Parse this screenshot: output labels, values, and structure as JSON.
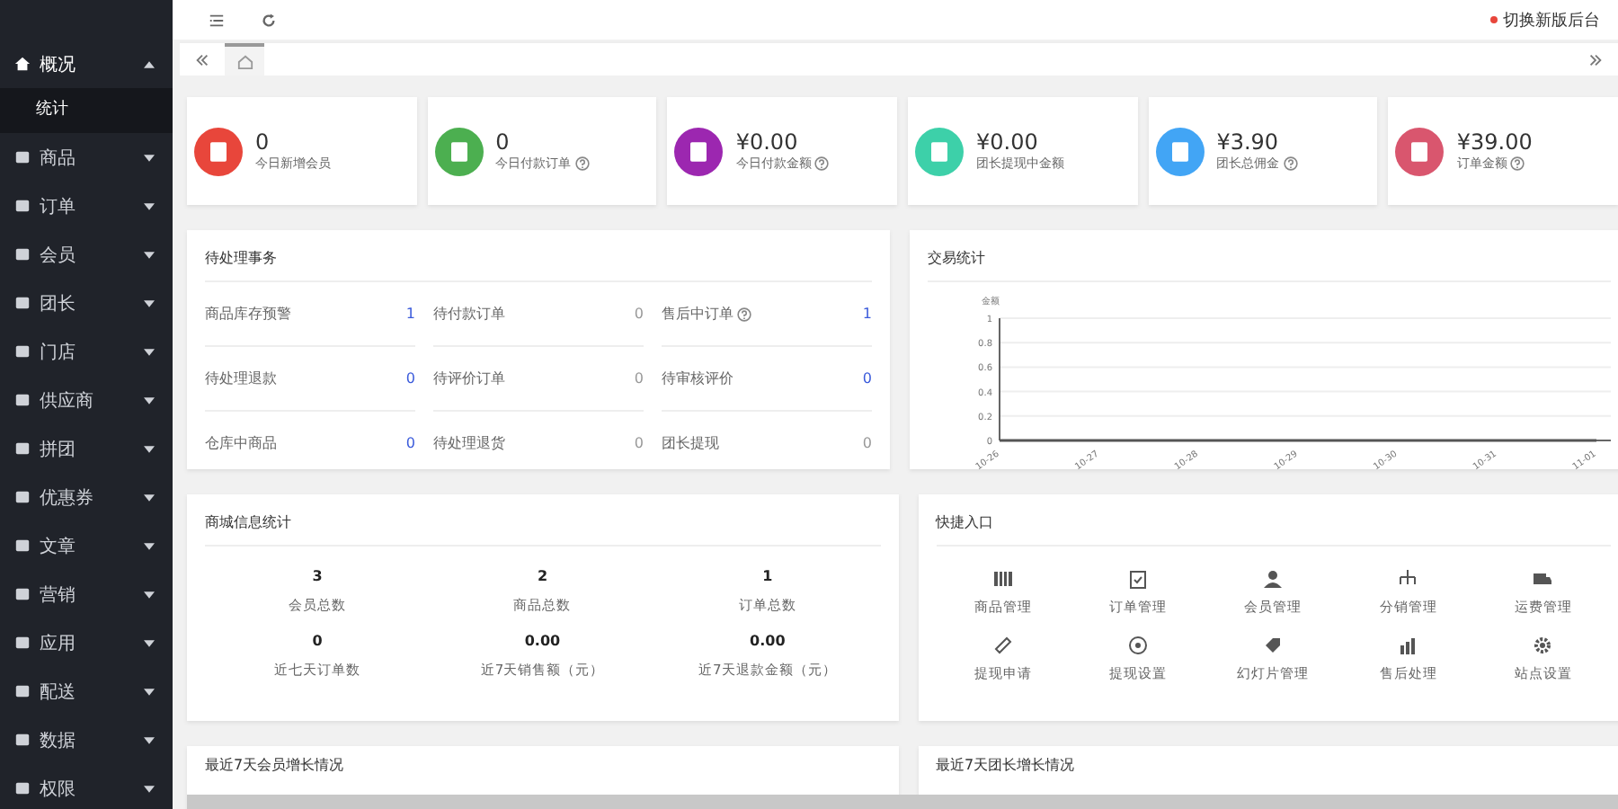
{
  "topbar": {
    "switch_link": "切换新版后台"
  },
  "sidebar": {
    "items": [
      {
        "label": "概况",
        "expanded": true,
        "children": [
          {
            "label": "统计",
            "selected": true
          }
        ]
      },
      {
        "label": "商品",
        "expanded": false
      },
      {
        "label": "订单",
        "expanded": false
      },
      {
        "label": "会员",
        "expanded": false
      },
      {
        "label": "团长",
        "expanded": false
      },
      {
        "label": "门店",
        "expanded": false
      },
      {
        "label": "供应商",
        "expanded": false
      },
      {
        "label": "拼团",
        "expanded": false
      },
      {
        "label": "优惠券",
        "expanded": false
      },
      {
        "label": "文章",
        "expanded": false
      },
      {
        "label": "营销",
        "expanded": false
      },
      {
        "label": "应用",
        "expanded": false
      },
      {
        "label": "配送",
        "expanded": false
      },
      {
        "label": "数据",
        "expanded": false
      },
      {
        "label": "权限",
        "expanded": false
      }
    ]
  },
  "stat_cards": [
    {
      "value": "0",
      "label": "今日新增会员",
      "help": false,
      "color": "#e8463b"
    },
    {
      "value": "0",
      "label": "今日付款订单",
      "help": true,
      "color": "#4caf50"
    },
    {
      "value": "¥0.00",
      "label": "今日付款金额",
      "help": true,
      "color": "#9c27b0"
    },
    {
      "value": "¥0.00",
      "label": "团长提现中金额",
      "help": false,
      "color": "#3dd0a9"
    },
    {
      "value": "¥3.90",
      "label": "团长总佣金",
      "help": true,
      "color": "#42a5f5"
    },
    {
      "value": "¥39.00",
      "label": "订单金额",
      "help": true,
      "color": "#d9566e"
    }
  ],
  "todo": {
    "title": "待处理事务",
    "items": [
      {
        "label": "商品库存预警",
        "help": false,
        "value": "1",
        "highlight": true
      },
      {
        "label": "待付款订单",
        "help": false,
        "value": "0",
        "highlight": false
      },
      {
        "label": "售后中订单",
        "help": true,
        "value": "1",
        "highlight": true
      },
      {
        "label": "待处理退款",
        "help": false,
        "value": "0",
        "highlight": true
      },
      {
        "label": "待评价订单",
        "help": false,
        "value": "0",
        "highlight": false
      },
      {
        "label": "待审核评价",
        "help": false,
        "value": "0",
        "highlight": true
      },
      {
        "label": "仓库中商品",
        "help": false,
        "value": "0",
        "highlight": true
      },
      {
        "label": "待处理退货",
        "help": false,
        "value": "0",
        "highlight": false
      },
      {
        "label": "团长提现",
        "help": false,
        "value": "0",
        "highlight": false
      }
    ]
  },
  "trade": {
    "title": "交易统计",
    "chart_data": {
      "type": "line",
      "grid": true,
      "categories": [
        "10-26",
        "10-27",
        "10-28",
        "10-29",
        "10-30",
        "10-31",
        "11-01"
      ],
      "series": [
        {
          "name": "金额",
          "color": "#555555",
          "values": [
            0,
            0,
            0,
            0,
            0,
            0,
            0
          ]
        }
      ],
      "ylim": [
        0,
        1
      ],
      "yticks": [
        0,
        {
          "value": 0.2,
          "label": "0.2"
        },
        {
          "value": 0.4,
          "label": "0.4"
        },
        {
          "value": 0.6,
          "label": "0.6"
        },
        {
          "value": 0.8,
          "label": "0.8"
        },
        1
      ]
    }
  },
  "mall": {
    "title": "商城信息统计",
    "stats": [
      {
        "value": "3",
        "label": "会员总数"
      },
      {
        "value": "2",
        "label": "商品总数"
      },
      {
        "value": "1",
        "label": "订单总数"
      },
      {
        "value": "0",
        "label": "近七天订单数"
      },
      {
        "value": "0.00",
        "label": "近7天销售额（元）"
      },
      {
        "value": "0.00",
        "label": "近7天退款金额（元）"
      }
    ]
  },
  "shortcuts": {
    "title": "快捷入口",
    "items": [
      {
        "kind": "list",
        "label": "商品管理"
      },
      {
        "kind": "clipboard",
        "label": "订单管理"
      },
      {
        "kind": "users",
        "label": "会员管理"
      },
      {
        "kind": "tree",
        "label": "分销管理"
      },
      {
        "kind": "truck",
        "label": "运费管理"
      },
      {
        "kind": "ticket",
        "label": "提现申请"
      },
      {
        "kind": "coin",
        "label": "提现设置"
      },
      {
        "kind": "tag",
        "label": "幻灯片管理"
      },
      {
        "kind": "bars",
        "label": "售后处理"
      },
      {
        "kind": "gear",
        "label": "站点设置"
      }
    ]
  },
  "bottom_panels": [
    {
      "title": "最近7天会员增长情况"
    },
    {
      "title": "最近7天团长增长情况"
    }
  ]
}
